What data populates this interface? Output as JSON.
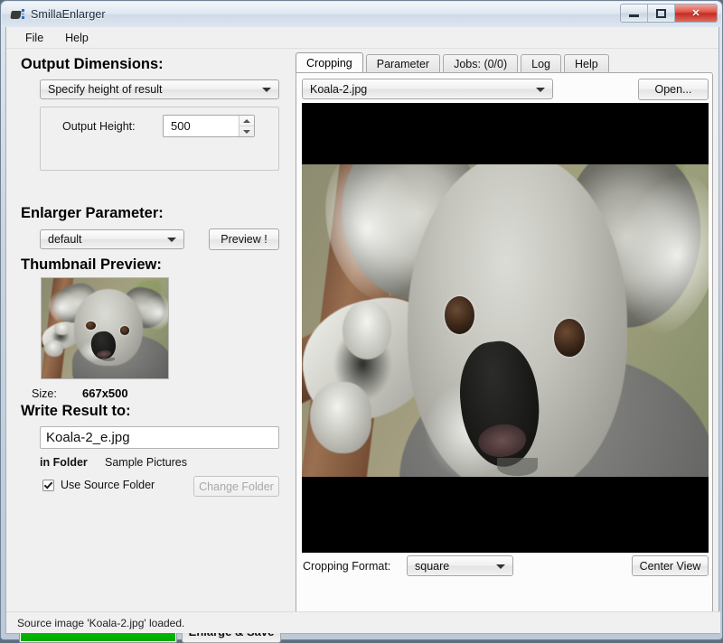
{
  "window": {
    "title": "SmillaEnlarger",
    "icon": "app-icon",
    "buttons": {
      "minimize": "minimize",
      "maximize": "maximize",
      "close": "✕"
    }
  },
  "menu": {
    "items": [
      "File",
      "Help"
    ]
  },
  "left": {
    "output_dimensions_heading": "Output Dimensions:",
    "mode_combo": {
      "value": "Specify height of result"
    },
    "output_height_label": "Output Height:",
    "output_height_value": "500",
    "enlarger_parameter_heading": "Enlarger Parameter:",
    "parameter_combo": {
      "value": "default"
    },
    "preview_button": "Preview !",
    "thumbnail_heading": "Thumbnail Preview:",
    "size_label": "Size:",
    "size_value": "667x500",
    "write_result_heading": "Write Result to:",
    "output_filename": "Koala-2_e.jpg",
    "in_folder_label": "in Folder",
    "folder_value": "Sample Pictures",
    "use_source_folder_label": "Use Source Folder",
    "use_source_folder_checked": true,
    "change_folder_button": "Change Folder",
    "change_folder_enabled": false,
    "enlarge_save_button": "Enlarge & Save",
    "progress_percent": 100,
    "progress_color": "#00bc00"
  },
  "right": {
    "tabs": [
      {
        "label": "Cropping",
        "active": true
      },
      {
        "label": "Parameter",
        "active": false
      },
      {
        "label": "Jobs: (0/0)",
        "active": false
      },
      {
        "label": "Log",
        "active": false
      },
      {
        "label": "Help",
        "active": false
      }
    ],
    "file_combo": {
      "value": "Koala-2.jpg"
    },
    "open_button": "Open...",
    "cropping_format_label": "Cropping Format:",
    "cropping_format_combo": {
      "value": "square"
    },
    "center_view_button": "Center View",
    "preview_image": {
      "alt": "koala-photo",
      "letterbox_color": "#000000"
    }
  },
  "status": {
    "text": "Source image 'Koala-2.jpg' loaded."
  }
}
